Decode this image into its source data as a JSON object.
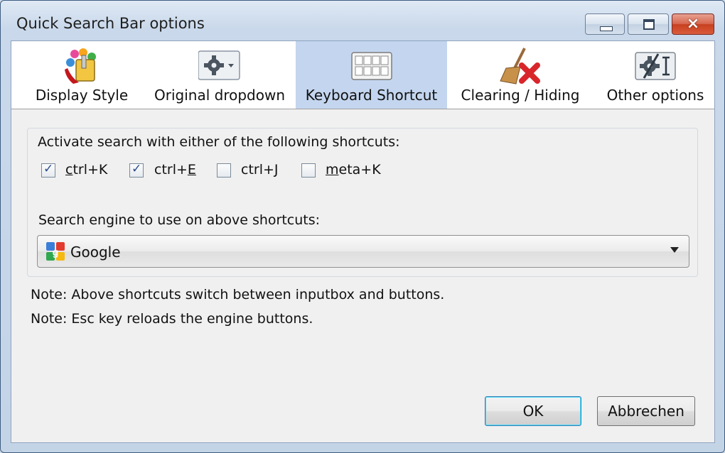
{
  "window": {
    "title": "Quick Search Bar options",
    "buttons": {
      "minimize": "minimize",
      "maximize": "maximize",
      "close": "×"
    }
  },
  "tabs": [
    {
      "label": "Display Style",
      "icon": "paint-palette-icon",
      "selected": false
    },
    {
      "label": "Original dropdown",
      "icon": "gear-dropdown-icon",
      "selected": false
    },
    {
      "label": "Keyboard Shortcut",
      "icon": "keyboard-icon",
      "selected": true
    },
    {
      "label": "Clearing / Hiding",
      "icon": "broom-clear-icon",
      "selected": false
    },
    {
      "label": "Other options",
      "icon": "gear-text-icon",
      "selected": false
    }
  ],
  "shortcuts": {
    "heading": "Activate search with either of the following shortcuts:",
    "options": [
      {
        "pre": "",
        "access": "c",
        "post": "trl+K",
        "checked": true
      },
      {
        "pre": "ctrl+",
        "access": "E",
        "post": "",
        "checked": true
      },
      {
        "pre": "ctrl+",
        "access": "J",
        "post": "",
        "checked": false
      },
      {
        "pre": "",
        "access": "m",
        "post": "eta+K",
        "checked": false
      }
    ]
  },
  "engine": {
    "label": "Search engine to use on above shortcuts:",
    "selected": "Google",
    "icon": "google-icon"
  },
  "notes": [
    "Note: Above shortcuts switch between inputbox and buttons.",
    "Note: Esc key reloads the engine buttons."
  ],
  "footer": {
    "ok": "OK",
    "cancel": "Abbrechen"
  },
  "colors": {
    "selected_tab": "#c4d6ef",
    "close_button": "#c7401f",
    "window_frame": "#c9d8ea"
  }
}
